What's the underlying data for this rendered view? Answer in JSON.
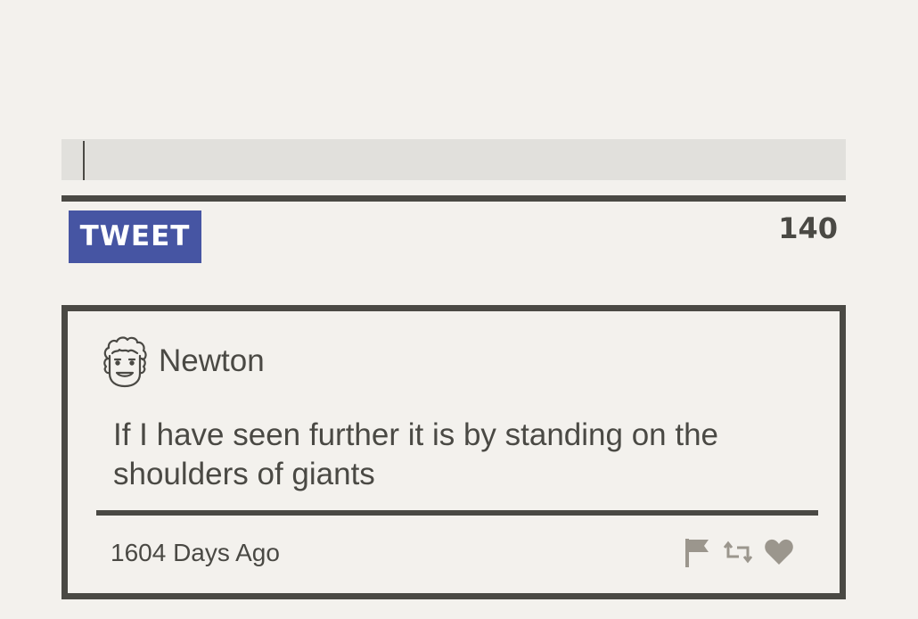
{
  "compose": {
    "value": "",
    "button_label": "TWEET",
    "char_count": "140"
  },
  "tweet": {
    "author": "Newton",
    "avatar_icon": "newton-face-icon",
    "text": "If I have seen further it is by standing on the shoulders of giants",
    "timestamp": "1604 Days Ago",
    "actions": [
      "flag-icon",
      "retweet-icon",
      "heart-icon"
    ]
  },
  "colors": {
    "background": "#f3f1ed",
    "ink": "#4a4944",
    "accent": "#4655a3",
    "input_bg": "#e1e0dc",
    "icon": "#9b968d"
  }
}
